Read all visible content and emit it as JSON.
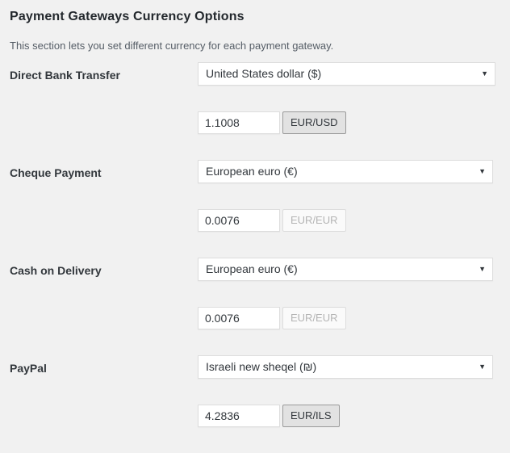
{
  "section": {
    "title": "Payment Gateways Currency Options",
    "description": "This section lets you set different currency for each payment gateway."
  },
  "icons": {
    "chevron_down": "▼"
  },
  "gateways": [
    {
      "label": "Direct Bank Transfer",
      "currency": "United States dollar ($)",
      "select_width": 369,
      "rate": "1.1008",
      "rate_button": "EUR/USD",
      "rate_button_state": "enabled"
    },
    {
      "label": "Cheque Payment",
      "currency": "European euro (€)",
      "select_width": 366,
      "rate": "0.0076",
      "rate_button": "EUR/EUR",
      "rate_button_state": "disabled"
    },
    {
      "label": "Cash on Delivery",
      "currency": "European euro (€)",
      "select_width": 366,
      "rate": "0.0076",
      "rate_button": "EUR/EUR",
      "rate_button_state": "disabled"
    },
    {
      "label": "PayPal",
      "currency": "Israeli new sheqel (₪)",
      "select_width": 366,
      "rate": "4.2836",
      "rate_button": "EUR/ILS",
      "rate_button_state": "enabled"
    }
  ]
}
